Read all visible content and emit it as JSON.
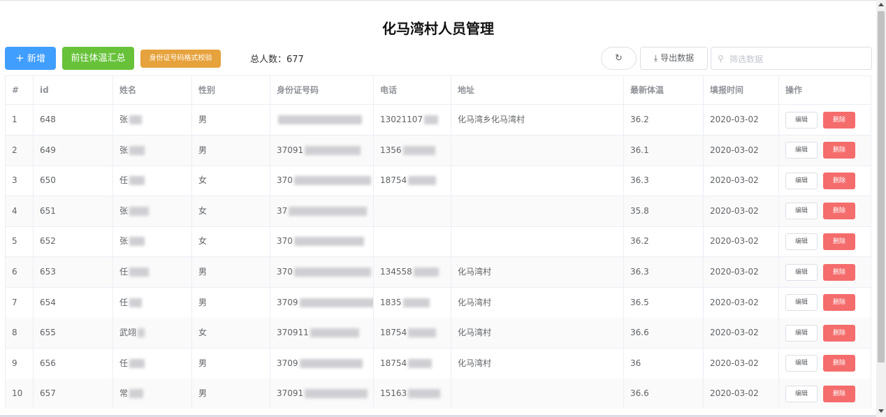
{
  "page": {
    "title": "化马湾村人员管理"
  },
  "toolbar": {
    "add_label": "新增",
    "add_icon": "plus-icon",
    "temp_summary_label": "前往体温汇总",
    "id_check_label": "身份证号码格式校验",
    "total_label": "总人数：677",
    "refresh_icon": "refresh-icon",
    "export_label": "导出数据",
    "export_icon": "download-icon",
    "search_placeholder": "筛选数据",
    "search_icon": "search-icon"
  },
  "table": {
    "columns": [
      "#",
      "id",
      "姓名",
      "性别",
      "身份证号码",
      "电话",
      "地址",
      "最新体温",
      "填报时间",
      "操作"
    ],
    "edit_label": "编辑",
    "delete_label": "删除",
    "rows": [
      {
        "no": "1",
        "id": "648",
        "name": "张",
        "gender": "男",
        "idcard": "",
        "phone": "13021107",
        "address": "化马湾乡化马湾村",
        "temp": "36.2",
        "date": "2020-03-02"
      },
      {
        "no": "2",
        "id": "649",
        "name": "张",
        "gender": "男",
        "idcard": "37091",
        "phone": "1356",
        "address": "",
        "temp": "36.1",
        "date": "2020-03-02"
      },
      {
        "no": "3",
        "id": "650",
        "name": "任",
        "gender": "女",
        "idcard": "370",
        "phone": "18754",
        "address": "",
        "temp": "36.3",
        "date": "2020-03-02"
      },
      {
        "no": "4",
        "id": "651",
        "name": "张",
        "gender": "女",
        "idcard": "37",
        "phone": "",
        "address": "",
        "temp": "35.8",
        "date": "2020-03-02"
      },
      {
        "no": "5",
        "id": "652",
        "name": "张",
        "gender": "女",
        "idcard": "370",
        "phone": "",
        "address": "",
        "temp": "36.2",
        "date": "2020-03-02"
      },
      {
        "no": "6",
        "id": "653",
        "name": "任",
        "gender": "男",
        "idcard": "370",
        "phone": "134558",
        "address": "化马湾村",
        "temp": "36.3",
        "date": "2020-03-02"
      },
      {
        "no": "7",
        "id": "654",
        "name": "任",
        "gender": "男",
        "idcard": "3709",
        "phone": "1835",
        "address": "化马湾村",
        "temp": "36.5",
        "date": "2020-03-02"
      },
      {
        "no": "8",
        "id": "655",
        "name": "武翊",
        "gender": "女",
        "idcard": "370911",
        "phone": "18754",
        "address": "化马湾村",
        "temp": "36.6",
        "date": "2020-03-02"
      },
      {
        "no": "9",
        "id": "656",
        "name": "任",
        "gender": "男",
        "idcard": "3709",
        "phone": "18754",
        "address": "化马湾村",
        "temp": "36",
        "date": "2020-03-02"
      },
      {
        "no": "10",
        "id": "657",
        "name": "常",
        "gender": "男",
        "idcard": "37091",
        "phone": "15163",
        "address": "",
        "temp": "36.6",
        "date": "2020-03-02"
      }
    ]
  }
}
